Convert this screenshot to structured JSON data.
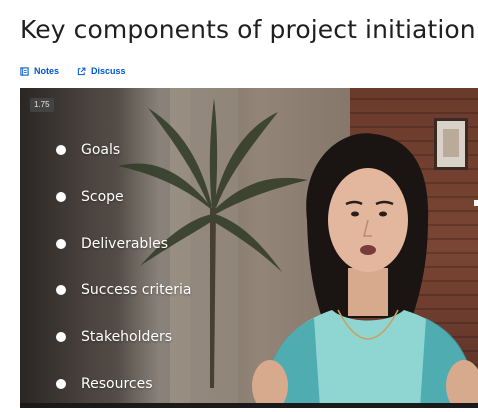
{
  "page": {
    "title": "Key components of project initiation"
  },
  "actions": {
    "notes_label": "Notes",
    "discuss_label": "Discuss",
    "notes_icon": "notes-icon",
    "discuss_icon": "external-link-icon",
    "accent_color": "#0056d2"
  },
  "video": {
    "speed_label": "1.75",
    "bullets": [
      "Goals",
      "Scope",
      "Deliverables",
      "Success criteria",
      "Stakeholders",
      "Resources"
    ]
  }
}
